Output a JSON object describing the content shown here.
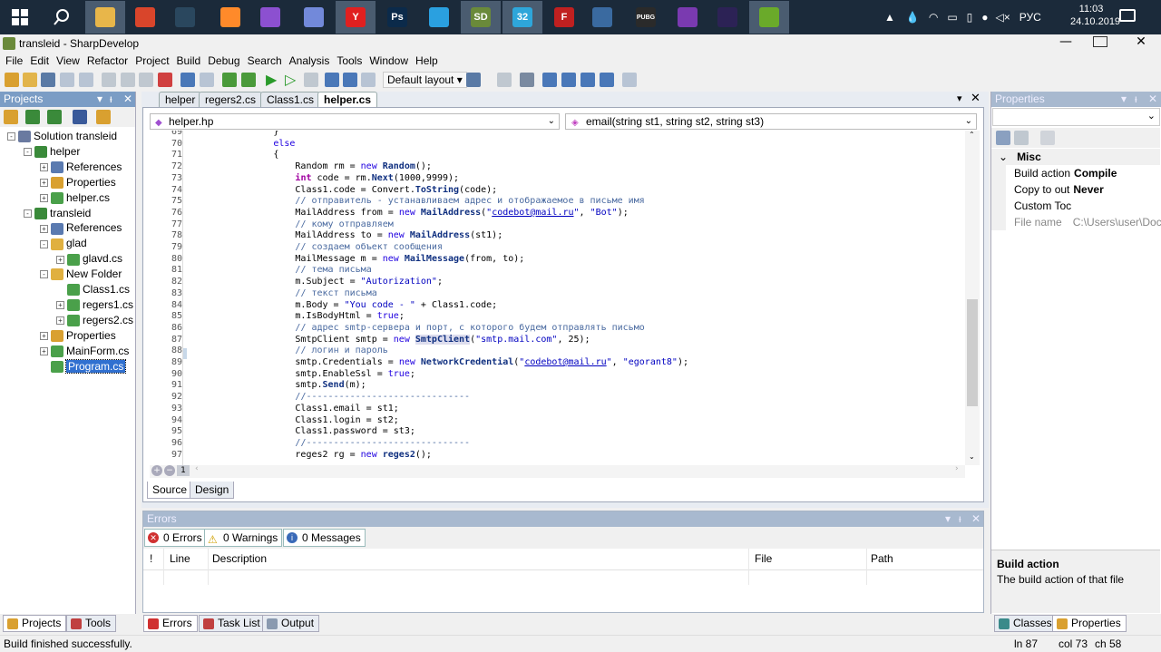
{
  "taskbar": {
    "clock_time": "11:03",
    "clock_date": "24.10.2019",
    "language": "РУС",
    "apps": [
      {
        "icon": "file-explorer-icon",
        "color": "#e8b64a",
        "label": ""
      },
      {
        "icon": "shield-app-icon",
        "color": "#d9452b",
        "label": ""
      },
      {
        "icon": "steam-icon",
        "color": "#2a475e",
        "label": ""
      },
      {
        "icon": "sublime-icon",
        "color": "#ff8a2a",
        "label": ""
      },
      {
        "icon": "visual-studio-icon",
        "color": "#8c50d0",
        "label": ""
      },
      {
        "icon": "discord-icon",
        "color": "#7289da",
        "label": ""
      },
      {
        "icon": "yandex-browser-icon",
        "color": "#e02020",
        "label": "Y"
      },
      {
        "icon": "photoshop-icon",
        "color": "#0b2a4a",
        "label": "Ps"
      },
      {
        "icon": "bird-app-icon",
        "color": "#2aa0e0",
        "label": ""
      },
      {
        "icon": "sharpdevelop-icon",
        "color": "#6a8a3a",
        "label": "SD"
      },
      {
        "icon": "telegram-icon",
        "color": "#2ea6da",
        "label": "32"
      },
      {
        "icon": "filezilla-icon",
        "color": "#c02020",
        "label": "F"
      },
      {
        "icon": "keyboard-app-icon",
        "color": "#3a6aa0",
        "label": ""
      },
      {
        "icon": "pubg-icon",
        "color": "#2a2a2a",
        "label": "PUBG"
      },
      {
        "icon": "podcast-icon",
        "color": "#7a3ab0",
        "label": ""
      },
      {
        "icon": "eclipse-icon",
        "color": "#2c2255",
        "label": ""
      },
      {
        "icon": "notepad-app-icon",
        "color": "#6aaa2a",
        "label": ""
      }
    ]
  },
  "window": {
    "title": "transleid - SharpDevelop"
  },
  "menu": [
    "File",
    "Edit",
    "View",
    "Refactor",
    "Project",
    "Build",
    "Debug",
    "Search",
    "Analysis",
    "Tools",
    "Window",
    "Help"
  ],
  "toolbar": {
    "layout_select": "Default layout"
  },
  "projects_pane": {
    "title": "Projects",
    "tree": [
      {
        "label": "Solution transleid",
        "indent": 0,
        "icon": "solution-icon",
        "exp": "-"
      },
      {
        "label": "helper",
        "indent": 1,
        "icon": "project-icon",
        "exp": "-"
      },
      {
        "label": "References",
        "indent": 2,
        "icon": "references-icon",
        "exp": "+"
      },
      {
        "label": "Properties",
        "indent": 2,
        "icon": "properties-icon",
        "exp": "+"
      },
      {
        "label": "helper.cs",
        "indent": 2,
        "icon": "cs-file-icon",
        "exp": "+"
      },
      {
        "label": "transleid",
        "indent": 1,
        "icon": "project-icon",
        "exp": "-"
      },
      {
        "label": "References",
        "indent": 2,
        "icon": "references-icon",
        "exp": "+"
      },
      {
        "label": "glad",
        "indent": 2,
        "icon": "folder-icon",
        "exp": "-"
      },
      {
        "label": "glavd.cs",
        "indent": 3,
        "icon": "cs-file-icon",
        "exp": "+"
      },
      {
        "label": "New Folder",
        "indent": 2,
        "icon": "folder-icon",
        "exp": "-"
      },
      {
        "label": "Class1.cs",
        "indent": 3,
        "icon": "cs-file-icon",
        "exp": ""
      },
      {
        "label": "regers1.cs",
        "indent": 3,
        "icon": "cs-file-icon",
        "exp": "+"
      },
      {
        "label": "regers2.cs",
        "indent": 3,
        "icon": "cs-file-icon",
        "exp": "+"
      },
      {
        "label": "Properties",
        "indent": 2,
        "icon": "properties-icon",
        "exp": "+"
      },
      {
        "label": "MainForm.cs",
        "indent": 2,
        "icon": "cs-file-icon",
        "exp": "+"
      },
      {
        "label": "Program.cs",
        "indent": 2,
        "icon": "cs-file-icon",
        "exp": "",
        "selected": true
      }
    ],
    "bottom_tabs": [
      "Projects",
      "Tools"
    ]
  },
  "editor": {
    "tabs": [
      "helper",
      "regers2.cs",
      "Class1.cs",
      "helper.cs"
    ],
    "active_tab": 3,
    "class_combo": "helper.hp",
    "member_combo": "email(string st1, string st2, string st3)",
    "lines": [
      {
        "n": "69",
        "html": "                }"
      },
      {
        "n": "70",
        "html": "                <span class='kw'>else</span>"
      },
      {
        "n": "71",
        "html": "                {"
      },
      {
        "n": "72",
        "html": "                    Random rm = <span class='kw'>new</span> <span class='fn'>Random</span>();"
      },
      {
        "n": "73",
        "html": "                    <span class='kwb'>int</span> code = rm.<span class='fn'>Next</span>(1000,9999);"
      },
      {
        "n": "74",
        "html": "                    Class1.code = Convert.<span class='fn'>ToString</span>(code);"
      },
      {
        "n": "75",
        "html": "                    <span class='cm'>// отправитель - устанавливаем адрес и отображаемое в письме имя</span>"
      },
      {
        "n": "76",
        "html": "                    MailAddress from = <span class='kw'>new</span> <span class='fn'>MailAddress</span>(<span class='st'>\"<span class='ul'>codebot@mail.ru</span>\"</span>, <span class='st'>\"Bot\"</span>);"
      },
      {
        "n": "77",
        "html": "                    <span class='cm'>// кому отправляем</span>"
      },
      {
        "n": "78",
        "html": "                    MailAddress to = <span class='kw'>new</span> <span class='fn'>MailAddress</span>(st1);"
      },
      {
        "n": "79",
        "html": "                    <span class='cm'>// создаем объект сообщения</span>"
      },
      {
        "n": "80",
        "html": "                    MailMessage m = <span class='kw'>new</span> <span class='fn'>MailMessage</span>(from, to);"
      },
      {
        "n": "81",
        "html": "                    <span class='cm'>// тема письма</span>"
      },
      {
        "n": "82",
        "html": "                    m.Subject = <span class='st'>\"Autorization\"</span>;"
      },
      {
        "n": "83",
        "html": "                    <span class='cm'>// текст письма</span>"
      },
      {
        "n": "84",
        "html": "                    m.Body = <span class='st'>\"You code - \"</span> + Class1.code;"
      },
      {
        "n": "85",
        "html": "                    m.IsBodyHtml = <span class='kw'>true</span>;"
      },
      {
        "n": "86",
        "html": "                    <span class='cm'>// адрес smtp-сервера и порт, с которого будем отправлять письмо</span>"
      },
      {
        "n": "87",
        "html": "                    SmtpClient smtp = <span class='kw'>new</span> <span class='fn' style='background:#dde'>SmtpClient</span>(<span class='st'>\"smtp.mail.com\"</span>, 25);"
      },
      {
        "n": "88",
        "html": "                    <span class='cm'>// логин и пароль</span>"
      },
      {
        "n": "89",
        "html": "                    smtp.Credentials = <span class='kw'>new</span> <span class='fn'>NetworkCredential</span>(<span class='st'>\"<span class='ul'>codebot@mail.ru</span>\"</span>, <span class='st'>\"egorant8\"</span>);"
      },
      {
        "n": "90",
        "html": "                    smtp.EnableSsl = <span class='kw'>true</span>;"
      },
      {
        "n": "91",
        "html": "                    smtp.<span class='fn'>Send</span>(m);"
      },
      {
        "n": "92",
        "html": "                    <span class='cm'>//------------------------------</span>"
      },
      {
        "n": "93",
        "html": "                    Class1.email = st1;"
      },
      {
        "n": "94",
        "html": "                    Class1.login = st2;"
      },
      {
        "n": "95",
        "html": "                    Class1.password = st3;"
      },
      {
        "n": "96",
        "html": "                    <span class='cm'>//------------------------------</span>"
      },
      {
        "n": "97",
        "html": "                    reges2 rg = <span class='kw'>new</span> <span class='fn'>reges2</span>();"
      }
    ],
    "zoom_value": "1",
    "view_tabs": [
      "Source",
      "Design"
    ]
  },
  "errors_pane": {
    "title": "Errors",
    "errors_btn": "0 Errors",
    "warnings_btn": "0 Warnings",
    "messages_btn": "0 Messages",
    "columns": [
      "!",
      "Line",
      "Description",
      "File",
      "Path"
    ],
    "bottom_tabs": [
      "Errors",
      "Task List",
      "Output"
    ]
  },
  "properties_pane": {
    "title": "Properties",
    "category": "Misc",
    "rows": [
      {
        "name": "Build action",
        "value": "Compile",
        "bold": true
      },
      {
        "name": "Copy to out",
        "value": "Never",
        "bold": true
      },
      {
        "name": "Custom Toc",
        "value": "",
        "bold": false
      },
      {
        "name": "File name",
        "value": "C:\\Users\\user\\Docu",
        "bold": false,
        "gray": true
      }
    ],
    "help_title": "Build action",
    "help_text": "The build action of that file",
    "bottom_tabs": [
      "Classes",
      "Properties"
    ]
  },
  "statusbar": {
    "message": "Build finished successfully.",
    "line": "ln 87",
    "col": "col 73",
    "ch": "ch 58"
  }
}
